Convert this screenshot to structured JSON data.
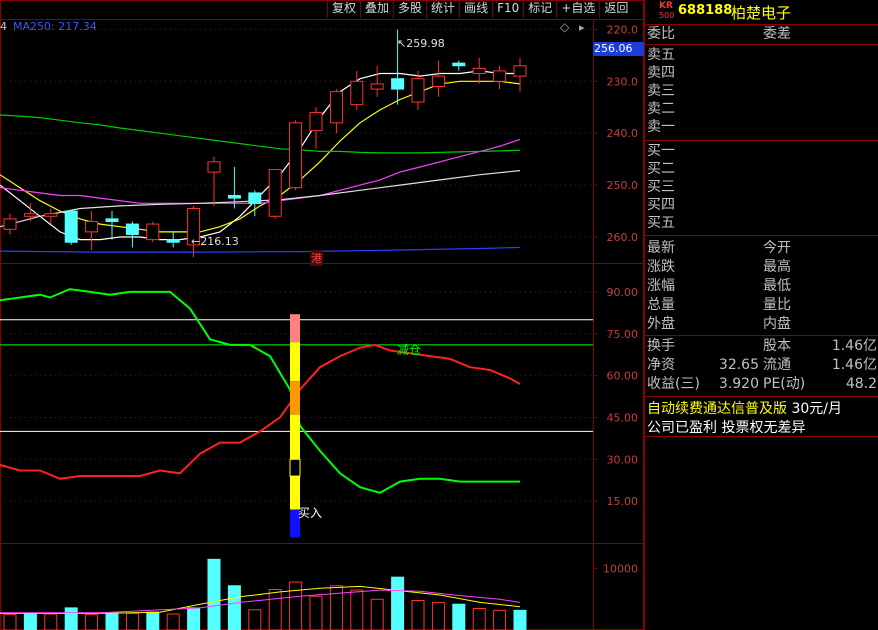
{
  "toolbar": {
    "buttons": [
      "复权",
      "叠加",
      "多股",
      "统计",
      "画线",
      "F10",
      "标记",
      "+自选",
      "返回"
    ]
  },
  "main_chart": {
    "ma_legend_prefix": "4",
    "ma_label": "MA250: 217.34",
    "current_price_tag": "256.06",
    "high_annotation": "259.98",
    "low_annotation": "216.13",
    "hk_marker": "港",
    "y_ticks": [
      "260.0",
      "250.0",
      "240.0",
      "230.0",
      "220.0"
    ]
  },
  "indicator": {
    "y_ticks": [
      "90.00",
      "75.00",
      "60.00",
      "45.00",
      "30.00",
      "15.00"
    ],
    "buy_label": "买入",
    "cross_label": "减仓"
  },
  "volume": {
    "y_ticks": [
      "10000"
    ]
  },
  "quote_panel": {
    "logo_top": "KR",
    "logo_bottom": "500",
    "code": "688188",
    "name": "柏楚电子",
    "weibi_label": "委比",
    "weicha_label": "委差",
    "asks": [
      "卖五",
      "卖四",
      "卖三",
      "卖二",
      "卖一"
    ],
    "bids": [
      "买一",
      "买二",
      "买三",
      "买四",
      "买五"
    ],
    "stats": [
      {
        "l": "最新",
        "m": "今开"
      },
      {
        "l": "涨跌",
        "m": "最高"
      },
      {
        "l": "涨幅",
        "m": "最低"
      },
      {
        "l": "总量",
        "m": "量比"
      },
      {
        "l": "外盘",
        "m": "内盘"
      }
    ],
    "fund": [
      {
        "l": "换手",
        "v1": "",
        "m": "股本",
        "v2": "1.46亿"
      },
      {
        "l": "净资",
        "v1": "32.65",
        "m": "流通",
        "v2": "1.46亿"
      },
      {
        "l": "收益(三)",
        "v1": "3.920",
        "m": "PE(动)",
        "v2": "48.2"
      }
    ],
    "promo": "自动续费通达信普及版",
    "promo_price": "30元/月",
    "note": "公司已盈利 投票权无差异"
  },
  "chart_data": {
    "type": "candlestick",
    "price_axis": {
      "ylim": [
        215,
        262
      ],
      "ticks": [
        220,
        230,
        240,
        250,
        260
      ]
    },
    "candles": [
      {
        "o": 221.5,
        "c": 223.5,
        "h": 224.5,
        "l": 220.5
      },
      {
        "o": 224.0,
        "c": 224.5,
        "h": 226.5,
        "l": 223.0
      },
      {
        "o": 224.0,
        "c": 224.5,
        "h": 225.5,
        "l": 222.5
      },
      {
        "o": 225.0,
        "c": 219.0,
        "h": 225.0,
        "l": 218.5
      },
      {
        "o": 221.0,
        "c": 223.0,
        "h": 225.0,
        "l": 217.5
      },
      {
        "o": 223.5,
        "c": 223.0,
        "h": 225.0,
        "l": 219.5
      },
      {
        "o": 222.5,
        "c": 220.5,
        "h": 223.0,
        "l": 218.0
      },
      {
        "o": 219.5,
        "c": 222.5,
        "h": 223.0,
        "l": 219.0
      },
      {
        "o": 219.5,
        "c": 219.0,
        "h": 221.0,
        "l": 218.0
      },
      {
        "o": 218.5,
        "c": 225.5,
        "h": 226.0,
        "l": 216.13
      },
      {
        "o": 232.5,
        "c": 234.5,
        "h": 235.5,
        "l": 226.0
      },
      {
        "o": 228.0,
        "c": 227.5,
        "h": 233.5,
        "l": 225.5
      },
      {
        "o": 228.5,
        "c": 226.5,
        "h": 229.0,
        "l": 224.0
      },
      {
        "o": 224.0,
        "c": 233.0,
        "h": 233.0,
        "l": 223.5
      },
      {
        "o": 229.5,
        "c": 242.0,
        "h": 242.5,
        "l": 229.0
      },
      {
        "o": 240.5,
        "c": 244.0,
        "h": 245.0,
        "l": 237.0
      },
      {
        "o": 242.0,
        "c": 248.0,
        "h": 248.5,
        "l": 240.0
      },
      {
        "o": 245.5,
        "c": 250.0,
        "h": 252.0,
        "l": 244.5
      },
      {
        "o": 248.5,
        "c": 249.5,
        "h": 253.0,
        "l": 247.0
      },
      {
        "o": 250.5,
        "c": 248.5,
        "h": 259.98,
        "l": 245.5
      },
      {
        "o": 246.0,
        "c": 250.5,
        "h": 252.0,
        "l": 244.5
      },
      {
        "o": 249.0,
        "c": 251.0,
        "h": 254.0,
        "l": 247.0
      },
      {
        "o": 253.5,
        "c": 253.0,
        "h": 254.0,
        "l": 252.0
      },
      {
        "o": 251.5,
        "c": 252.5,
        "h": 254.5,
        "l": 249.5
      },
      {
        "o": 250.0,
        "c": 252.0,
        "h": 253.0,
        "l": 248.5
      },
      {
        "o": 251.0,
        "c": 253.0,
        "h": 254.5,
        "l": 248.0
      }
    ],
    "ma_lines": [
      {
        "name": "MA5",
        "color": "#ffffff",
        "values": [
          [
            0,
            230
          ],
          [
            20,
            227
          ],
          [
            40,
            224
          ],
          [
            60,
            221
          ],
          [
            80,
            219.5
          ],
          [
            100,
            219.5
          ],
          [
            120,
            220
          ],
          [
            140,
            220
          ],
          [
            160,
            219.5
          ],
          [
            180,
            219.5
          ],
          [
            200,
            220
          ],
          [
            220,
            221
          ],
          [
            240,
            224
          ],
          [
            260,
            228
          ],
          [
            280,
            232
          ],
          [
            300,
            237
          ],
          [
            320,
            243
          ],
          [
            340,
            248
          ],
          [
            360,
            250.5
          ],
          [
            380,
            251.5
          ],
          [
            400,
            251.5
          ],
          [
            420,
            251
          ],
          [
            440,
            251.5
          ],
          [
            460,
            251.5
          ],
          [
            480,
            252
          ],
          [
            500,
            251.5
          ],
          [
            520,
            251.5
          ]
        ]
      },
      {
        "name": "MA10",
        "color": "#ffff00",
        "values": [
          [
            0,
            232
          ],
          [
            20,
            229.5
          ],
          [
            40,
            227
          ],
          [
            60,
            225
          ],
          [
            80,
            223.5
          ],
          [
            100,
            222.5
          ],
          [
            120,
            222
          ],
          [
            140,
            221.5
          ],
          [
            160,
            221
          ],
          [
            180,
            221
          ],
          [
            200,
            221
          ],
          [
            220,
            222
          ],
          [
            240,
            223.5
          ],
          [
            260,
            226
          ],
          [
            280,
            228
          ],
          [
            300,
            231
          ],
          [
            320,
            234.5
          ],
          [
            340,
            238.5
          ],
          [
            360,
            242
          ],
          [
            380,
            244.5
          ],
          [
            400,
            246.5
          ],
          [
            420,
            248
          ],
          [
            440,
            249.5
          ],
          [
            460,
            250
          ],
          [
            480,
            250
          ],
          [
            500,
            250
          ],
          [
            520,
            249.5
          ]
        ]
      },
      {
        "name": "MA20",
        "color": "#ff40ff",
        "values": [
          [
            0,
            229.5
          ],
          [
            20,
            229
          ],
          [
            40,
            228.5
          ],
          [
            60,
            228
          ],
          [
            80,
            228
          ],
          [
            100,
            227.5
          ],
          [
            120,
            227
          ],
          [
            140,
            226.5
          ],
          [
            160,
            226.5
          ],
          [
            180,
            226.5
          ],
          [
            200,
            226.5
          ],
          [
            220,
            226.5
          ],
          [
            240,
            226.5
          ],
          [
            260,
            226.5
          ],
          [
            280,
            227
          ],
          [
            300,
            227.5
          ],
          [
            320,
            228
          ],
          [
            340,
            229
          ],
          [
            360,
            230
          ],
          [
            380,
            231
          ],
          [
            400,
            232.5
          ],
          [
            420,
            233.5
          ],
          [
            440,
            234.5
          ],
          [
            460,
            235.5
          ],
          [
            480,
            236.5
          ],
          [
            500,
            237.5
          ],
          [
            520,
            238.8
          ]
        ]
      },
      {
        "name": "MA60",
        "color": "#00cc00",
        "values": [
          [
            0,
            243.5
          ],
          [
            20,
            243.3
          ],
          [
            40,
            243
          ],
          [
            60,
            242.5
          ],
          [
            80,
            242
          ],
          [
            100,
            241.6
          ],
          [
            120,
            241
          ],
          [
            140,
            240.5
          ],
          [
            160,
            240
          ],
          [
            180,
            239.5
          ],
          [
            200,
            239
          ],
          [
            220,
            238.5
          ],
          [
            240,
            238
          ],
          [
            260,
            237.5
          ],
          [
            280,
            237
          ],
          [
            300,
            236.8
          ],
          [
            320,
            236.5
          ],
          [
            340,
            236.5
          ],
          [
            360,
            236.3
          ],
          [
            380,
            236.2
          ],
          [
            400,
            236.2
          ],
          [
            420,
            236.2
          ],
          [
            440,
            236.3
          ],
          [
            460,
            236.4
          ],
          [
            480,
            236.5
          ],
          [
            500,
            236.6
          ],
          [
            520,
            236.7
          ]
        ]
      },
      {
        "name": "MA120",
        "color": "#e0e0e0",
        "values": [
          [
            0,
            222
          ],
          [
            40,
            224
          ],
          [
            80,
            225.5
          ],
          [
            120,
            226
          ],
          [
            160,
            226.3
          ],
          [
            200,
            226.5
          ],
          [
            240,
            226.8
          ],
          [
            280,
            227.2
          ],
          [
            320,
            228
          ],
          [
            360,
            229
          ],
          [
            400,
            230
          ],
          [
            440,
            231
          ],
          [
            480,
            232
          ],
          [
            520,
            232.8
          ]
        ]
      },
      {
        "name": "MA250",
        "color": "#2a40ff",
        "values": [
          [
            0,
            217.3
          ],
          [
            100,
            217.1
          ],
          [
            200,
            217.1
          ],
          [
            300,
            217.2
          ],
          [
            400,
            217.5
          ],
          [
            480,
            217.8
          ],
          [
            520,
            218
          ]
        ]
      }
    ],
    "indicator_axis": {
      "ylim": [
        0,
        100
      ],
      "ticks": [
        90,
        75,
        60,
        45,
        30,
        15
      ],
      "ref_lines": [
        80,
        71,
        40
      ]
    },
    "green_line": [
      [
        0,
        87
      ],
      [
        20,
        88
      ],
      [
        40,
        89
      ],
      [
        50,
        88
      ],
      [
        70,
        91
      ],
      [
        90,
        90
      ],
      [
        110,
        89
      ],
      [
        130,
        90
      ],
      [
        150,
        90
      ],
      [
        170,
        90
      ],
      [
        190,
        84
      ],
      [
        210,
        73
      ],
      [
        230,
        71
      ],
      [
        250,
        71
      ],
      [
        270,
        67
      ],
      [
        290,
        55
      ],
      [
        300,
        42
      ],
      [
        320,
        33
      ],
      [
        340,
        25
      ],
      [
        360,
        20
      ],
      [
        380,
        18
      ],
      [
        400,
        22
      ],
      [
        420,
        23
      ],
      [
        440,
        23
      ],
      [
        460,
        22
      ],
      [
        480,
        22
      ],
      [
        500,
        22
      ],
      [
        520,
        22
      ]
    ],
    "red_line": [
      [
        0,
        28
      ],
      [
        20,
        26
      ],
      [
        40,
        26
      ],
      [
        60,
        23
      ],
      [
        80,
        24
      ],
      [
        100,
        24
      ],
      [
        120,
        24
      ],
      [
        140,
        24
      ],
      [
        160,
        26
      ],
      [
        180,
        25
      ],
      [
        200,
        32
      ],
      [
        220,
        36
      ],
      [
        240,
        36
      ],
      [
        260,
        40
      ],
      [
        280,
        45
      ],
      [
        300,
        55
      ],
      [
        320,
        63
      ],
      [
        340,
        67
      ],
      [
        360,
        70
      ],
      [
        375,
        71
      ],
      [
        390,
        69
      ],
      [
        410,
        68
      ],
      [
        430,
        67
      ],
      [
        450,
        66
      ],
      [
        470,
        63
      ],
      [
        490,
        62
      ],
      [
        510,
        59
      ],
      [
        520,
        57
      ]
    ],
    "volume_axis": {
      "ylim": [
        0,
        14000
      ],
      "ticks": [
        10000
      ]
    },
    "volume": [
      {
        "v": 2500,
        "up": true
      },
      {
        "v": 2600,
        "up": false
      },
      {
        "v": 2600,
        "up": true
      },
      {
        "v": 3600,
        "up": false
      },
      {
        "v": 2500,
        "up": true
      },
      {
        "v": 2700,
        "up": false
      },
      {
        "v": 2700,
        "up": true
      },
      {
        "v": 2900,
        "up": false
      },
      {
        "v": 2600,
        "up": true
      },
      {
        "v": 3600,
        "up": false
      },
      {
        "v": 11500,
        "up": false
      },
      {
        "v": 7200,
        "up": false
      },
      {
        "v": 3300,
        "up": true
      },
      {
        "v": 6600,
        "up": true
      },
      {
        "v": 7800,
        "up": true
      },
      {
        "v": 5500,
        "up": true
      },
      {
        "v": 7200,
        "up": true
      },
      {
        "v": 6500,
        "up": true
      },
      {
        "v": 5000,
        "up": true
      },
      {
        "v": 8600,
        "up": false
      },
      {
        "v": 4800,
        "up": true
      },
      {
        "v": 4500,
        "up": true
      },
      {
        "v": 4200,
        "up": false
      },
      {
        "v": 3500,
        "up": true
      },
      {
        "v": 3200,
        "up": true
      },
      {
        "v": 3200,
        "up": false
      }
    ],
    "vol_ma1": [
      [
        0,
        2700
      ],
      [
        100,
        2700
      ],
      [
        160,
        2900
      ],
      [
        200,
        4200
      ],
      [
        240,
        5400
      ],
      [
        280,
        6200
      ],
      [
        320,
        6800
      ],
      [
        360,
        7100
      ],
      [
        400,
        6400
      ],
      [
        440,
        5700
      ],
      [
        480,
        4500
      ],
      [
        520,
        3800
      ]
    ],
    "vol_ma2": [
      [
        0,
        2800
      ],
      [
        100,
        2800
      ],
      [
        200,
        3600
      ],
      [
        240,
        4500
      ],
      [
        300,
        5500
      ],
      [
        340,
        6000
      ],
      [
        380,
        6500
      ],
      [
        420,
        6300
      ],
      [
        460,
        5600
      ],
      [
        500,
        5000
      ],
      [
        520,
        4500
      ]
    ],
    "signal": {
      "x": 295
    }
  }
}
